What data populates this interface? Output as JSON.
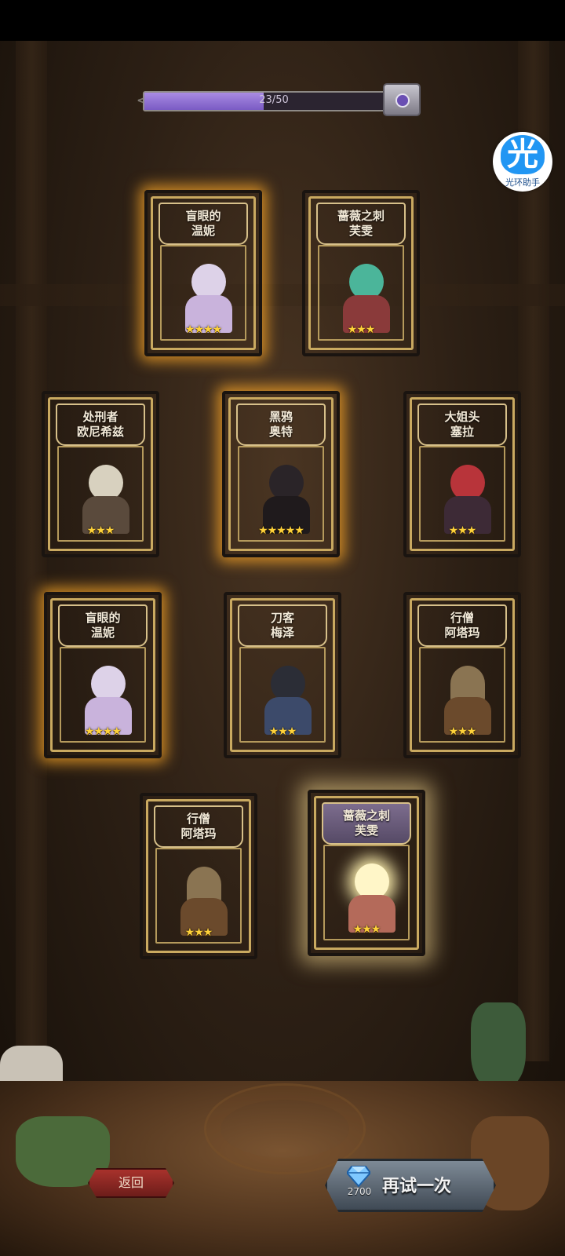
{
  "progress": {
    "text": "23/50",
    "current": 23,
    "max": 50
  },
  "assistant": {
    "char": "光",
    "label": "光环助手"
  },
  "cards": [
    {
      "title1": "盲眼的",
      "title2": "温妮",
      "stars": "★★★★",
      "star_count": 4,
      "theme": "green"
    },
    {
      "title1": "蔷薇之刺",
      "title2": "芙雯",
      "stars": "★★★",
      "star_count": 3,
      "theme": "purple"
    },
    {
      "title1": "处刑者",
      "title2": "欧尼希兹",
      "stars": "★★★",
      "star_count": 3,
      "theme": "purple"
    },
    {
      "title1": "黑鸦",
      "title2": "奥特",
      "stars": "★★★★★",
      "star_count": 5,
      "theme": "purple"
    },
    {
      "title1": "大姐头",
      "title2": "塞拉",
      "stars": "★★★",
      "star_count": 3,
      "theme": "red"
    },
    {
      "title1": "盲眼的",
      "title2": "温妮",
      "stars": "★★★★",
      "star_count": 4,
      "theme": "green"
    },
    {
      "title1": "刀客",
      "title2": "梅泽",
      "stars": "★★★",
      "star_count": 3,
      "theme": "green"
    },
    {
      "title1": "行僧",
      "title2": "阿塔玛",
      "stars": "★★★",
      "star_count": 3,
      "theme": "green"
    },
    {
      "title1": "行僧",
      "title2": "阿塔玛",
      "stars": "★★★",
      "star_count": 3,
      "theme": "green"
    },
    {
      "title1": "蔷薇之刺",
      "title2": "芙雯",
      "stars": "★★★",
      "star_count": 3,
      "theme": "white"
    }
  ],
  "buttons": {
    "back": "返回",
    "retry": "再试一次",
    "retry_cost": "2700"
  },
  "icons": {
    "gem": "diamond-icon",
    "chest": "treasure-chest-icon"
  }
}
